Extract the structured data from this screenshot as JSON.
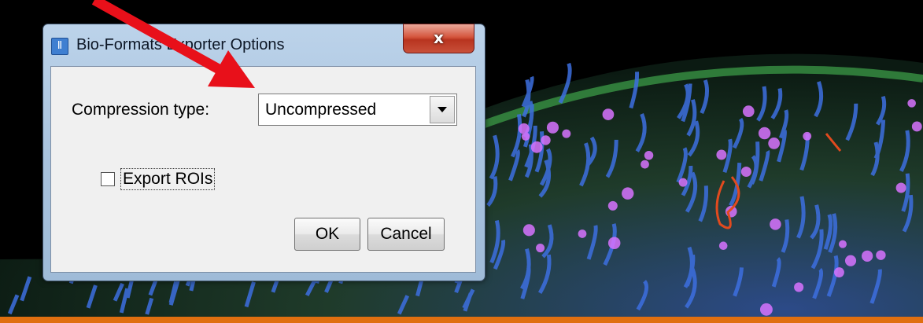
{
  "dialog": {
    "title": "Bio-Formats Exporter Options",
    "close_glyph": "x",
    "app_icon": "imagej-icon",
    "compression_label": "Compression type:",
    "compression_value": "Uncompressed",
    "export_rois_label": "Export ROIs",
    "export_rois_checked": false,
    "ok_label": "OK",
    "cancel_label": "Cancel"
  },
  "annotation": {
    "color": "#e8101a",
    "icon": "red-arrow-icon"
  },
  "background": {
    "image": "fluorescence-microscopy-tissue"
  }
}
